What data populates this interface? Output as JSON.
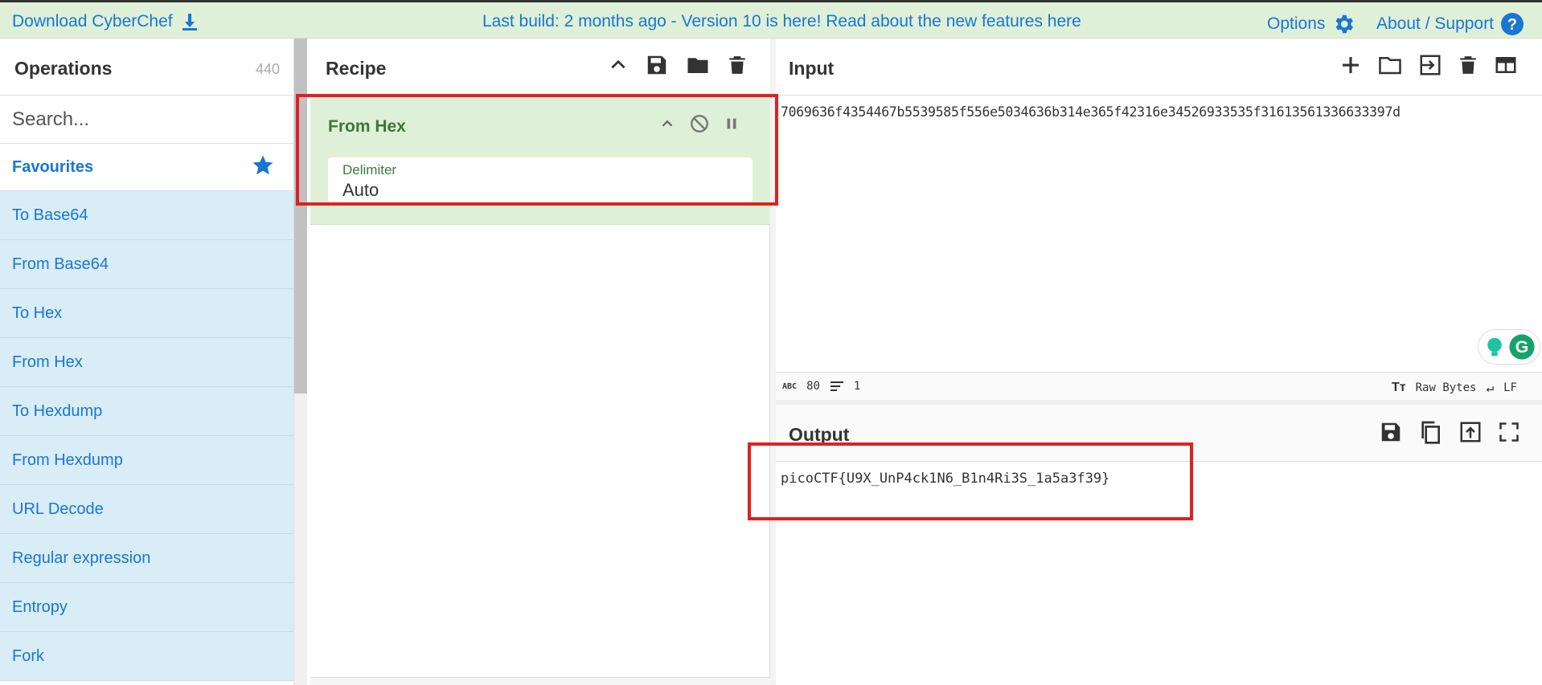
{
  "banner": {
    "download_label": "Download CyberChef",
    "build_notice": "Last build: 2 months ago - Version 10 is here! Read about the new features here",
    "options_label": "Options",
    "about_label": "About / Support"
  },
  "operations": {
    "title": "Operations",
    "count": "440",
    "search_placeholder": "Search...",
    "favourites_label": "Favourites",
    "items": [
      "To Base64",
      "From Base64",
      "To Hex",
      "From Hex",
      "To Hexdump",
      "From Hexdump",
      "URL Decode",
      "Regular expression",
      "Entropy",
      "Fork"
    ]
  },
  "recipe": {
    "title": "Recipe",
    "operation": {
      "name": "From Hex",
      "arg_label": "Delimiter",
      "arg_value": "Auto"
    }
  },
  "input": {
    "title": "Input",
    "text": "7069636f4354467b5539585f556e5034636b314e365f42316e34526933535f31613561336633397d",
    "status": {
      "char_count": "80",
      "line_count": "1",
      "encoding": "Raw Bytes",
      "eol": "LF"
    }
  },
  "output": {
    "title": "Output",
    "text": "picoCTF{U9X_UnP4ck1N6_B1n4Ri3S_1a5a3f39}"
  },
  "colors": {
    "accent_blue": "#1976d2",
    "banner_green": "#dff0d8",
    "op_green": "#3c763d",
    "list_blue": "#d9edf7",
    "highlight_red": "#e02020"
  }
}
